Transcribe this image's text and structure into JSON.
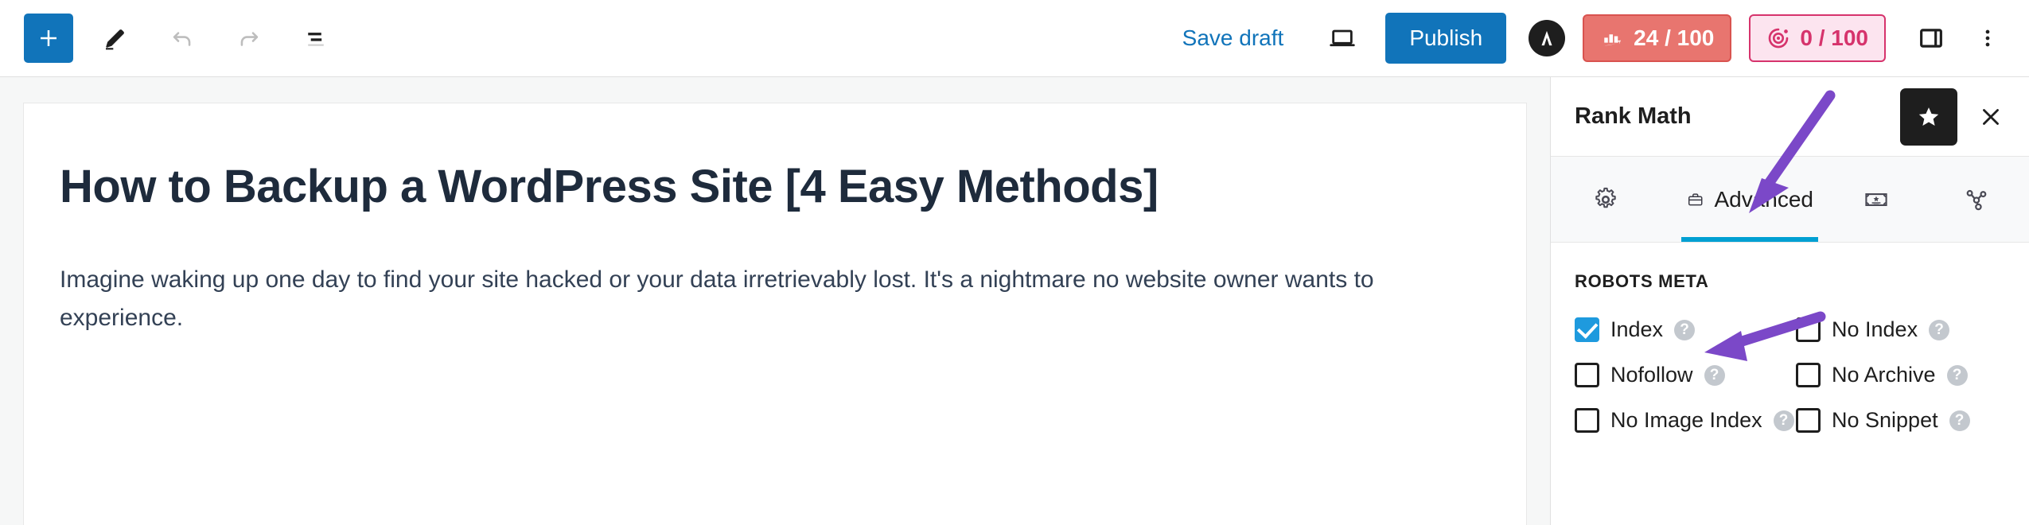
{
  "toolbar": {
    "add_block_label": "Add block",
    "tools_label": "Tools",
    "undo_label": "Undo",
    "redo_label": "Redo",
    "list_view_label": "Document overview",
    "save_draft_label": "Save draft",
    "preview_label": "Preview",
    "publish_label": "Publish",
    "avatar_label": "A",
    "sidebar_toggle_label": "Settings",
    "options_label": "Options",
    "badges": [
      {
        "name": "seo-score",
        "value": "24 / 100",
        "icon": "seo-bar-chart-icon",
        "bg": "#e8756f",
        "border": "#d9534f",
        "text": "#ffffff"
      },
      {
        "name": "ai-score",
        "value": "0 / 100",
        "icon": "ai-target-icon",
        "bg": "#fce4ef",
        "border": "#d6336c",
        "text": "#d6336c"
      }
    ]
  },
  "editor": {
    "title": "How to Backup a WordPress Site [4 Easy Methods]",
    "paragraph": "Imagine waking up one day to find your site hacked or your data irretrievably lost. It's a nightmare no website owner wants to experience."
  },
  "rank_math": {
    "title": "Rank Math",
    "star_button_label": "★",
    "close_button_label": "✕",
    "tabs": [
      {
        "id": "general",
        "label": "",
        "icon": "gear-icon",
        "active": false
      },
      {
        "id": "advanced",
        "label": "Advanced",
        "icon": "briefcase-icon",
        "active": true
      },
      {
        "id": "schema",
        "label": "",
        "icon": "schema-certificate-icon",
        "active": false
      },
      {
        "id": "social",
        "label": "",
        "icon": "social-share-icon",
        "active": false
      }
    ],
    "section_title": "ROBOTS META",
    "help_glyph": "?",
    "checkboxes": [
      {
        "id": "index",
        "label": "Index",
        "checked": true
      },
      {
        "id": "no-index",
        "label": "No Index",
        "checked": false
      },
      {
        "id": "nofollow",
        "label": "Nofollow",
        "checked": false
      },
      {
        "id": "no-archive",
        "label": "No Archive",
        "checked": false
      },
      {
        "id": "no-image-index",
        "label": "No Image Index",
        "checked": false
      },
      {
        "id": "no-snippet",
        "label": "No Snippet",
        "checked": false
      }
    ]
  },
  "annotations": {
    "accent_color": "#7b48c8",
    "arrows": [
      {
        "name": "arrow-to-advanced-tab"
      },
      {
        "name": "arrow-to-index-checkbox"
      }
    ]
  },
  "colors": {
    "primary_blue": "#1174ba",
    "tab_active_blue": "#00a0d2",
    "checkbox_blue": "#1e9ade",
    "canvas_gray": "#f6f7f7"
  }
}
